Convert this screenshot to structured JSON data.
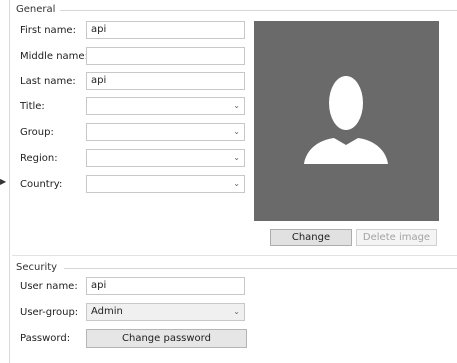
{
  "general": {
    "title": "General",
    "first_name": {
      "label": "First name:",
      "value": "api"
    },
    "middle_name": {
      "label": "Middle name:",
      "value": ""
    },
    "last_name": {
      "label": "Last name:",
      "value": "api"
    },
    "title_field": {
      "label": "Title:",
      "value": ""
    },
    "group": {
      "label": "Group:",
      "value": ""
    },
    "region": {
      "label": "Region:",
      "value": ""
    },
    "country": {
      "label": "Country:",
      "value": ""
    },
    "photo": {
      "icon": "user-silhouette-icon",
      "background": "#6a6a6a"
    },
    "change_label": "Change",
    "delete_image_label": "Delete image"
  },
  "security": {
    "title": "Security",
    "user_name": {
      "label": "User name:",
      "value": "api"
    },
    "user_group": {
      "label": "User-group:",
      "value": "Admin"
    },
    "password": {
      "label": "Password:",
      "button_label": "Change password"
    }
  },
  "icons": {
    "dropdown": "chevron-down-icon",
    "pointer": "arrow-right-icon"
  }
}
